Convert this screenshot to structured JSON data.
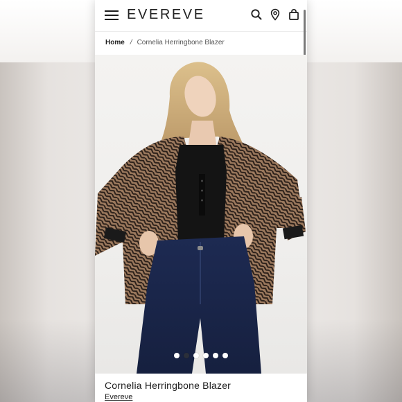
{
  "header": {
    "logo_text": "EVEREVE",
    "icons": [
      "menu-icon",
      "search-icon",
      "location-pin-icon",
      "shopping-bag-icon"
    ]
  },
  "breadcrumb": {
    "home": "Home",
    "separator": "/",
    "current": "Cornelia Herringbone Blazer"
  },
  "gallery": {
    "image_count": 6,
    "active_index": 1
  },
  "product": {
    "title": "Cornelia Herringbone Blazer",
    "brand": "Evereve"
  }
}
